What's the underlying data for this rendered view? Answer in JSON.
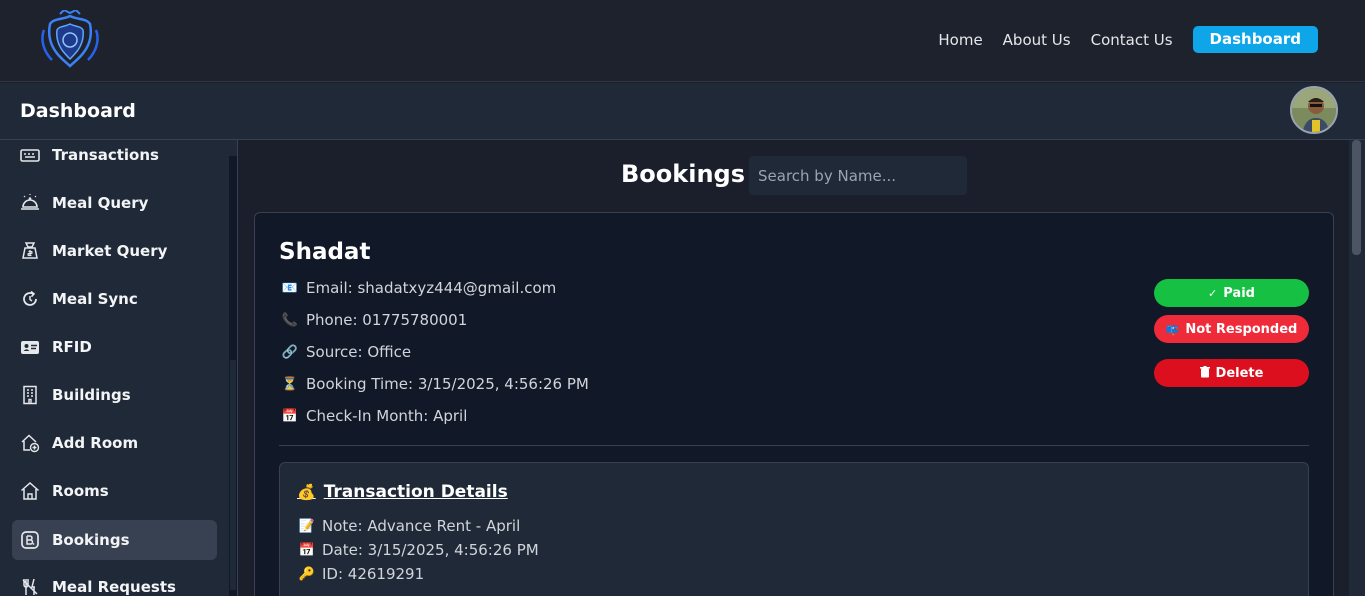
{
  "navbar": {
    "links": [
      "Home",
      "About Us",
      "Contact Us"
    ],
    "dashboard_button": "Dashboard"
  },
  "header": {
    "title": "Dashboard"
  },
  "sidebar": {
    "items": [
      {
        "label": "Transactions",
        "icon": "keyboard-icon"
      },
      {
        "label": "Meal Query",
        "icon": "cloche-icon"
      },
      {
        "label": "Market Query",
        "icon": "money-bag-icon"
      },
      {
        "label": "Meal Sync",
        "icon": "sync-icon"
      },
      {
        "label": "RFID",
        "icon": "id-card-icon"
      },
      {
        "label": "Buildings",
        "icon": "building-icon"
      },
      {
        "label": "Add Room",
        "icon": "house-plus-icon"
      },
      {
        "label": "Rooms",
        "icon": "house-icon"
      },
      {
        "label": "Bookings",
        "icon": "bookings-icon",
        "active": true
      },
      {
        "label": "Meal Requests",
        "icon": "utensils-icon"
      }
    ]
  },
  "main": {
    "title": "Bookings",
    "search_placeholder": "Search by Name...",
    "booking": {
      "name": "Shadat",
      "email": "Email: shadatxyz444@gmail.com",
      "phone": "Phone: 01775780001",
      "source": "Source: Office",
      "booking_time": "Booking Time: 3/15/2025, 4:56:26 PM",
      "checkin": "Check-In Month: April",
      "badges": {
        "paid": "Paid",
        "not_responded": "Not Responded",
        "delete": "Delete"
      },
      "transaction": {
        "title": "Transaction Details",
        "note": "Note: Advance Rent - April",
        "date": "Date: 3/15/2025, 4:56:26 PM",
        "id": "ID: 42619291"
      }
    }
  },
  "colors": {
    "accent": "#0ea5e9",
    "paid": "#16c043",
    "not_responded": "#ef2b3a",
    "delete": "#dc0f1f"
  }
}
